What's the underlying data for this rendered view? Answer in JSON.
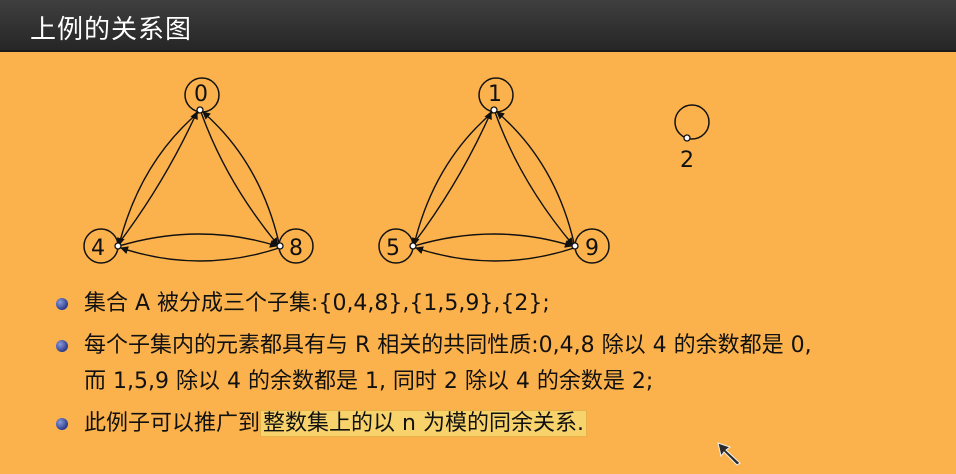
{
  "header": {
    "title": "上例的关系图"
  },
  "diagram": {
    "nodes": [
      {
        "id": "0",
        "label": "0"
      },
      {
        "id": "4",
        "label": "4"
      },
      {
        "id": "8",
        "label": "8"
      },
      {
        "id": "1",
        "label": "1"
      },
      {
        "id": "5",
        "label": "5"
      },
      {
        "id": "9",
        "label": "9"
      },
      {
        "id": "2",
        "label": "2"
      }
    ]
  },
  "bullets": [
    {
      "text": "集合 A 被分成三个子集:{0,4,8},{1,5,9},{2};"
    },
    {
      "line1": "每个子集内的元素都具有与 R 相关的共同性质:0,4,8 除以 4 的余数都是 0,",
      "line2": "而 1,5,9 除以 4 的余数都是 1, 同时 2 除以 4 的余数是 2;"
    },
    {
      "prefix": "此例子可以推广到",
      "highlight": "整数集上的以 n 为模的同余关系."
    }
  ],
  "colors": {
    "background": "#fbb24c",
    "title_bar": "#2e2e2e",
    "bullet": "#2c3a8c",
    "highlight": "#f8d36c"
  },
  "icons": {
    "cursor": "arrow-cursor-icon"
  }
}
